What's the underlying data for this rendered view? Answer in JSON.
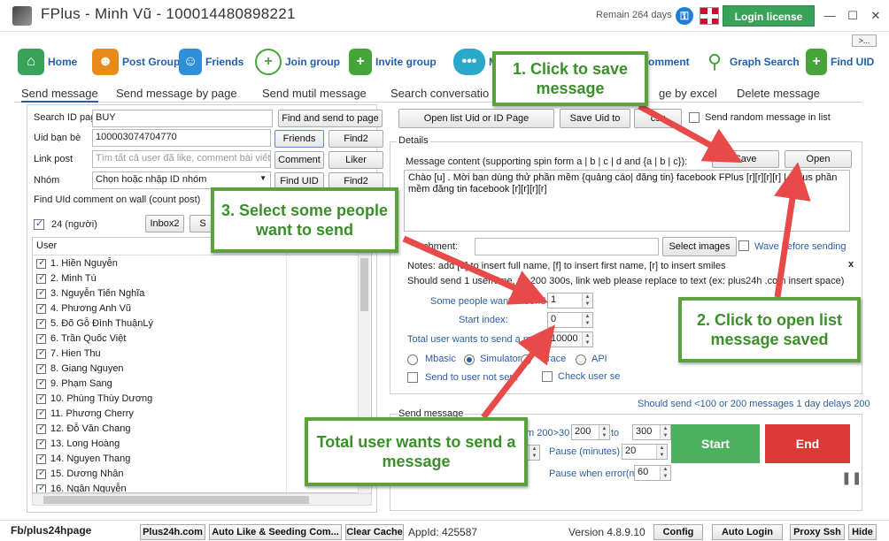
{
  "window": {
    "title": "FPlus - Minh Vũ - 100014480898221",
    "remain": "Remain 264 days",
    "login_license": "Login license",
    "more": ">..."
  },
  "nav": [
    {
      "label": "Home",
      "icon": "home-icon",
      "color": "#3aa35a"
    },
    {
      "label": "Post Group",
      "icon": "group-icon",
      "color": "#e98a1d"
    },
    {
      "label": "Friends",
      "icon": "friends-icon",
      "color": "#2f8fd8"
    },
    {
      "label": "Join group",
      "icon": "join-group-icon",
      "color": "#46a53a"
    },
    {
      "label": "Invite group",
      "icon": "invite-icon",
      "color": "#46a53a"
    },
    {
      "label": "M",
      "icon": "message-icon",
      "color": "#29a9c9"
    },
    {
      "label": "omment",
      "icon": "comment-icon",
      "color": "#46a53a"
    },
    {
      "label": "Graph Search",
      "icon": "search-icon",
      "color": "#46a53a"
    },
    {
      "label": "Find UID",
      "icon": "find-uid-icon",
      "color": "#46a53a"
    }
  ],
  "subtabs": [
    "Send message",
    "Send message by page",
    "Send mutil message",
    "Search conversatio",
    "ge by excel",
    "Delete message"
  ],
  "left": {
    "search_label": "Search ID pag",
    "search_value": "BUY",
    "find_send_page": "Find and send to page",
    "uid_label": "Uid bạn bè",
    "uid_value": "100003074704770",
    "friends_btn": "Friends",
    "find2_btn": "Find2",
    "link_label": "Link post",
    "link_placeholder": "Tìm tất cả user đã like, comment bài viết",
    "comment_btn": "Comment",
    "liker_btn": "Liker",
    "group_label": "Nhóm",
    "group_value": "Chọn hoặc nhập ID nhóm",
    "find_uid_btn": "Find UID",
    "find2b_btn": "Find2",
    "find_uid_wall": "Find UId comment on wall (count post)",
    "count": "24 (người)",
    "inbox2_btn": "Inbox2",
    "s_btn": "S",
    "user_header": "User"
  },
  "users": [
    "1. Hiền Nguyễn",
    "2. Minh Tú",
    "3. Nguyễn Tiến Nghĩa",
    "4. Phương Anh Vũ",
    "5. Đõ Gỗ Đình ThuậnLý",
    "6. Trần Quốc Việt",
    "7. Hien Thu",
    "8. Giang Nguyen",
    "9. Phạm Sang",
    "10. Phùng Thùy Dương",
    "11. Phương Cherry",
    "12. Đỗ Văn Chang",
    "13. Long Hoàng",
    "14. Nguyen Thang",
    "15. Dương Nhân",
    "16. Ngân Nguyễn"
  ],
  "right": {
    "open_list": "Open list Uid or ID Page",
    "save_uid": "Save Uid to",
    "csv": "csv",
    "random_msg": "Send random message in list",
    "details": "Details",
    "msg_content_label": "Message content (supporting spin form a | b | c | d and {a | b | c}):",
    "save_btn": "Save",
    "open_btn": "Open",
    "message": "Chào [u] . Mời bạn dùng thử phần mềm {quảng cáo| đăng tin} facebook FPlus [r][r][r][r] | Fplus phần mềm đăng tin facebook [r][r][r][r]",
    "attachment_label": "chment:",
    "select_images": "Select images",
    "wave": "Wave before sending",
    "notes": "Notes: add [u] to insert full name, [f] to insert first name, [r] to insert smiles",
    "close_x": "x",
    "should_send": "Should send 1 user/time,            ys 200 300s, link web please replace to text (ex: plus24h  .com insert space)",
    "some_people_label": "Some people want to send",
    "some_people_value": "1",
    "start_index_label": "Start index:",
    "start_index_value": "0",
    "total_label": "Total user wants to send a messa",
    "total_value": "10000",
    "mbasic": "Mbasic",
    "simulator": "Simulator",
    "race": "race",
    "api": "API",
    "send_not_sent": "Send to user not sent",
    "check_user": "Check user se",
    "should_send_limit": "Should send <100 or 200 messages 1 day delays 200",
    "send_message_group": "Send message",
    "delay_label": "m 200>30",
    "delay_from": "200",
    "to_label": "to",
    "delay_to": "300",
    "pause_min_label": "Pause (minutes)",
    "pause_min": "20",
    "pause_err_label": "Pause when error(m)",
    "pause_err": "60",
    "start_btn": "Start",
    "end_btn": "End"
  },
  "callouts": {
    "c1": "1. Click to save message",
    "c2": "2. Click to open list message saved",
    "c3": "3. Select some people want to send",
    "c4": "Total user wants to send a message"
  },
  "status": {
    "page": "Fb/plus24hpage",
    "plus24h": "Plus24h.com",
    "auto_like": "Auto Like & Seeding Com...",
    "clear_cache": "Clear Cache",
    "appid": "AppId: 425587",
    "version": "Version 4.8.9.10",
    "config": "Config",
    "auto_login": "Auto Login",
    "proxy": "Proxy Ssh",
    "hide": "Hide"
  }
}
